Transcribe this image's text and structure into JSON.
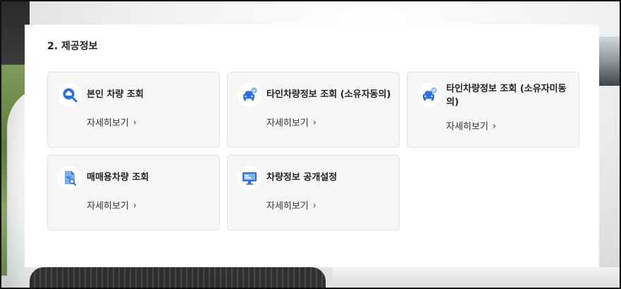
{
  "section": {
    "title": "2. 제공정보"
  },
  "cards": [
    {
      "title": "본인 차량 조회",
      "more": "자세히보기",
      "icon": "search-car-icon"
    },
    {
      "title": "타인차량정보 조회 (소유자동의)",
      "more": "자세히보기",
      "icon": "car-check-icon"
    },
    {
      "title": "타인차량정보 조회 (소유자미동의)",
      "more": "자세히보기",
      "icon": "car-question-icon"
    },
    {
      "title": "매매용차량 조회",
      "more": "자세히보기",
      "icon": "document-search-icon"
    },
    {
      "title": "차량정보 공개설정",
      "more": "자세히보기",
      "icon": "monitor-settings-icon"
    }
  ],
  "chevron": "›",
  "colors": {
    "icon_blue": "#2d6fe0",
    "icon_light_blue": "#7fb0f5",
    "card_bg": "#f6f6f7",
    "card_border": "#e3e3e5"
  }
}
